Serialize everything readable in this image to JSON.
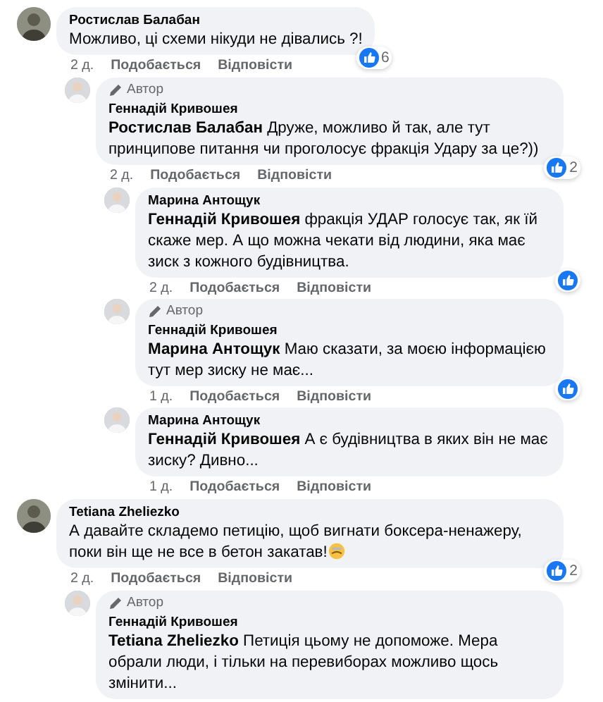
{
  "comments": [
    {
      "author": "Ростислав Балабан",
      "text": "Можливо, ці схеми нікуди не дівались ?!",
      "time": "2 д.",
      "like_label": "Подобається",
      "reply_label": "Відповісти",
      "reaction": true,
      "reaction_count": "6",
      "children": [
        {
          "badge": "Автор",
          "author": "Геннадій Кривошея",
          "text": "**Ростислав Балабан** Друже, можливо й так, але тут принципове питання чи проголосує фракція Удару за це?))",
          "time": "2 д.",
          "like_label": "Подобається",
          "reply_label": "Відповісти",
          "reaction": true,
          "reaction_count": "2",
          "children": [
            {
              "author": "Марина Антощук",
              "text": "**Геннадій Кривошея** фракція УДАР голосує так, як їй скаже мер. А що можна чекати від людини, яка має зиск з кожного будівництва.",
              "time": "2 д.",
              "like_label": "Подобається",
              "reply_label": "Відповісти",
              "reaction": true
            },
            {
              "badge": "Автор",
              "author": "Геннадій Кривошея",
              "text": "**Марина Антощук** Маю сказати, за моєю інформацією тут мер зиску не має...",
              "time": "1 д.",
              "like_label": "Подобається",
              "reply_label": "Відповісти",
              "reaction": true
            },
            {
              "author": "Марина Антощук",
              "text": "**Геннадій Кривошея** А є будівництва в яких він не має зиску? Дивно...",
              "time": "1 д.",
              "like_label": "Подобається",
              "reply_label": "Відповісти",
              "reaction": false
            }
          ]
        }
      ]
    },
    {
      "author": "Tetiana Zheliezko",
      "text": "А давайте складемо петицію, щоб вигнати боксера-ненажеру, поки він ще не все в бетон закатав!",
      "emoji": true,
      "time": "2 д.",
      "like_label": "Подобається",
      "reply_label": "Відповісти",
      "reaction": true,
      "reaction_count": "2",
      "children": [
        {
          "badge": "Автор",
          "author": "Геннадій Кривошея",
          "text": "**Tetiana Zheliezko** Петиція цьому не допоможе. Мера обрали люди, і тільки на перевиборах можливо щось змінити...",
          "reaction": false
        }
      ]
    }
  ]
}
